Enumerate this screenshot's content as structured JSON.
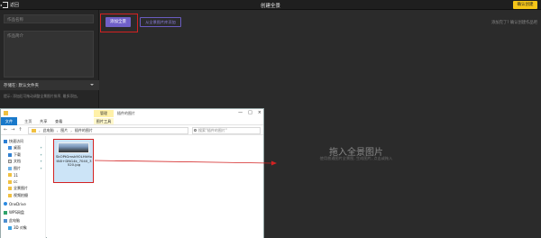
{
  "app": {
    "back_label": "返回",
    "title": "创建全景",
    "publish_label": "确认创建"
  },
  "left_panel": {
    "name_placeholder": "作品名称",
    "intro_placeholder": "作品简介",
    "folder_label": "存储在: 默认文件夹",
    "hint": "提示: 添加后可拖动调整全景图片排序, 最多添加。"
  },
  "toolbar": {
    "add_label": "添加全景",
    "from_library_label": "从全景图片库添加",
    "hint_right": "添加完了? 确认创建作品吧"
  },
  "dropzone": {
    "title": "拖入全景图片",
    "subtitle": "使用普通图片全景图, 生成图片, 点击或拖入"
  },
  "explorer": {
    "manage_tab": "管理",
    "folder_name": "插件的图片",
    "ribbon_tabs": [
      "文件",
      "主页",
      "共享",
      "查看",
      "图片工具"
    ],
    "address": [
      "此电脑",
      "图片",
      "插件的图片"
    ],
    "search_placeholder": "搜索\"插件的图片\"",
    "window_controls": [
      "—",
      "□",
      "×"
    ],
    "nav_arrows": [
      "←",
      "→",
      "↑"
    ],
    "nav_items": [
      {
        "label": "快速访问",
        "icon": "star-icon",
        "level": 0,
        "pin": false
      },
      {
        "label": "桌面",
        "icon": "desktop-icon",
        "level": 1,
        "pin": true
      },
      {
        "label": "下载",
        "icon": "download-icon",
        "level": 1,
        "pin": true
      },
      {
        "label": "文档",
        "icon": "document-icon",
        "level": 1,
        "pin": true
      },
      {
        "label": "图片",
        "icon": "picture-icon",
        "level": 1,
        "pin": true
      },
      {
        "label": "11",
        "icon": "folder-icon",
        "level": 1,
        "pin": false
      },
      {
        "label": "cc",
        "icon": "folder-icon",
        "level": 1,
        "pin": false
      },
      {
        "label": "全景图片",
        "icon": "folder-icon",
        "level": 1,
        "pin": false
      },
      {
        "label": "视频拍摄",
        "icon": "folder-icon",
        "level": 1,
        "pin": false
      },
      {
        "label": "OneDrive",
        "icon": "cloud-icon",
        "level": 0,
        "pin": false
      },
      {
        "label": "WPS网盘",
        "icon": "wps-icon",
        "level": 0,
        "pin": false
      },
      {
        "label": "此电脑",
        "icon": "computer-icon",
        "level": 0,
        "pin": false
      },
      {
        "label": "3D 对象",
        "icon": "cube-icon",
        "level": 1,
        "pin": false
      }
    ],
    "file": {
      "name": "SkOPtGmsk9OLHkHotN0+DNG4k_7040_3520.jpg"
    }
  }
}
